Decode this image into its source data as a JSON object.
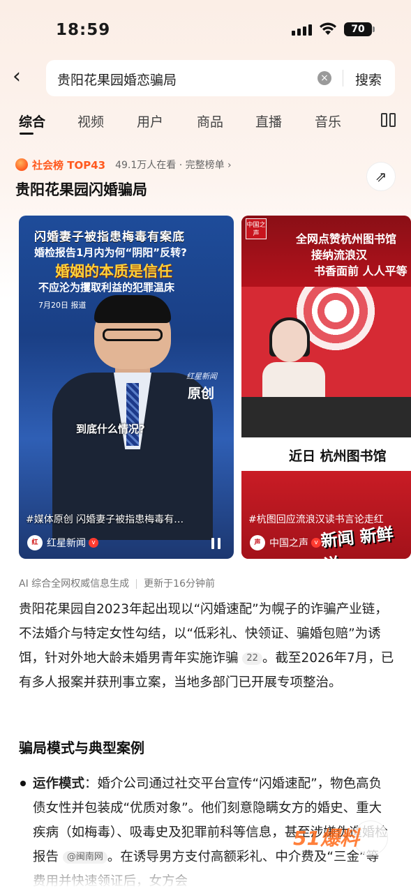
{
  "status": {
    "time": "18:59",
    "battery": "70"
  },
  "search": {
    "query": "贵阳花果园婚恋骗局",
    "button": "搜索"
  },
  "tabs": [
    "综合",
    "视频",
    "用户",
    "商品",
    "直播",
    "音乐"
  ],
  "rank": {
    "label": "社会榜 TOP43",
    "meta": "49.1万人在看 · 完整榜单 ›"
  },
  "topic_title": "贵阳花果园闪婚骗局",
  "videos": [
    {
      "headline1": "闪婚妻子被指患梅毒有案底",
      "headline2": "婚检报告1月内为何“阴阳”反转?",
      "headline3": "婚姻的本质是信任",
      "headline4": "不应沦为攫取利益的犯罪温床",
      "date": "7月20日 报道",
      "logo_small": "红星新闻",
      "logo_big": "原创",
      "subtitle": "到底什么情况?",
      "caption": "#媒体原创 闪婚妻子被指患梅毒有…",
      "source": "红星新闻"
    },
    {
      "logo": "中国之声",
      "headline1": "全网点赞杭州图书馆",
      "headline2": "接纳流浪汉",
      "headline3": "书香面前 人人平等",
      "band": "近日 杭州图书馆",
      "caption": "#杭图回应流浪汉读书言论走红",
      "source": "中国之声",
      "brand": "新闻 新鲜说"
    }
  ],
  "ai_info": {
    "label": "AI 综合全网权威信息生成",
    "updated": "更新于16分钟前"
  },
  "summary": {
    "text_before": "贵阳花果园自2023年起出现以“闪婚速配”为幌子的诈骗产业链，不法婚介与特定女性勾结，以“低彩礼、快领证、骗婚包赔”为诱饵，针对外地大龄未婚男青年实施诈骗",
    "ref": "22",
    "text_after": "。截至2026年7月，已有多人报案并获刑事立案，当地多部门已开展专项整治。"
  },
  "section_title": "骗局模式与典型案例",
  "bullet": {
    "label": "运作模式",
    "text": "：婚介公司通过社交平台宣传“闪婚速配”，物色高负债女性并包装成“优质对象”。他们刻意隐瞒女方的婚史、重大疾病（如梅毒）、吸毒史及犯罪前科等信息，甚至涉嫌伪造婚检报告",
    "ref": "@闽南网",
    "text_after": "。在诱导男方支付高额彩礼、中介费及“三金”等费用并快速领证后，女方会"
  },
  "watermark": "51爆料"
}
